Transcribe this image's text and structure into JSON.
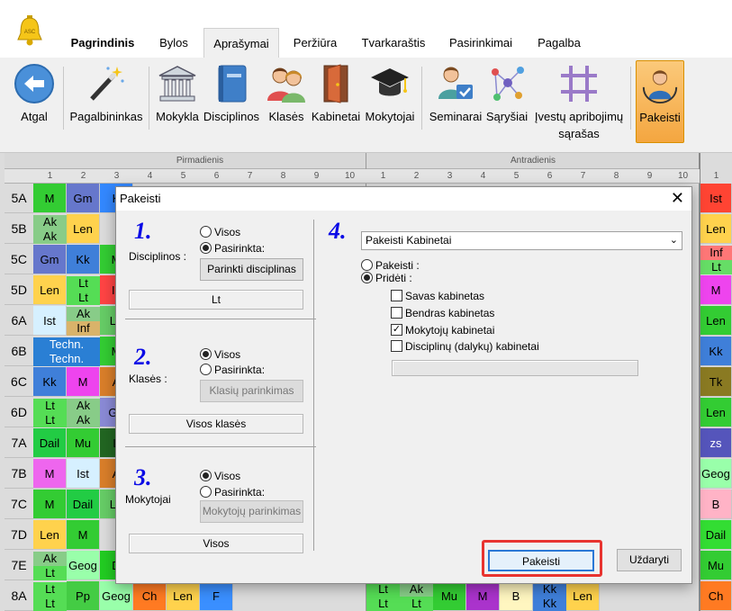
{
  "menu": {
    "tabs": [
      "Pagrindinis",
      "Bylos",
      "Aprašymai",
      "Peržiūra",
      "Tvarkaraštis",
      "Pasirinkimai",
      "Pagalba"
    ]
  },
  "app_logo_text": "ASC",
  "ribbon": {
    "atgal": "Atgal",
    "pagalbininkas": "Pagalbininkas",
    "mokykla": "Mokykla",
    "disciplinos": "Disciplinos",
    "klases": "Klasės",
    "kabinetai": "Kabinetai",
    "mokytojai": "Mokytojai",
    "seminarai": "Seminarai",
    "sarysiai": "Sąryšiai",
    "apribojimai_1": "Įvestų apribojimų",
    "apribojimai_2": "sąrašas",
    "pakeisti": "Pakeisti"
  },
  "grid": {
    "day1": "Pirmadienis",
    "day2": "Antradienis",
    "periods": [
      "1",
      "2",
      "3",
      "4",
      "5",
      "6",
      "7",
      "8",
      "9",
      "10"
    ],
    "right_col_header": "1",
    "rows": [
      "5A",
      "5B",
      "5C",
      "5D",
      "6A",
      "6B",
      "6C",
      "6D",
      "7A",
      "7B",
      "7C",
      "7D",
      "7E",
      "8A"
    ],
    "right_col": [
      "Ist",
      "Len",
      "Inf",
      "Lt",
      "M",
      "Len",
      "Kk",
      "Tk",
      "Len",
      "zs",
      "Geog",
      "B",
      "Dail",
      "Mu",
      "Ch"
    ],
    "cells": {
      "r5A": [
        "M",
        "Gm",
        "K"
      ],
      "r5B": [
        "Ak",
        "Ak",
        "Len"
      ],
      "r5C": [
        "Gm",
        "Kk",
        "M"
      ],
      "r5D": [
        "Len",
        "Lt",
        "Lt",
        "Is"
      ],
      "r6A": [
        "Ist",
        "Ak",
        "Inf",
        "Le"
      ],
      "r6B": [
        "Techn.",
        "Techn.",
        "M"
      ],
      "r6C": [
        "Kk",
        "M",
        "A"
      ],
      "r6D": [
        "Lt",
        "Lt",
        "Ak",
        "Ak",
        "Ge"
      ],
      "r7A": [
        "Dail",
        "Mu",
        "L"
      ],
      "r7B": [
        "M",
        "Ist",
        "A"
      ],
      "r7C": [
        "M",
        "Dail",
        "Le"
      ],
      "r7D": [
        "Len",
        "M"
      ],
      "r7E": [
        "Ak",
        "Lt",
        "Geog",
        "D"
      ],
      "r8A": [
        "Lt",
        "Lt",
        "Pp",
        "Geog",
        "Ch",
        "Len",
        "F",
        "Lt",
        "Lt",
        "Ak",
        "Lt",
        "Mu",
        "M",
        "B",
        "Kk",
        "Kk",
        "Len"
      ]
    }
  },
  "dialog": {
    "title": "Pakeisti",
    "close": "✕",
    "s1_num": "1.",
    "s1_label": "Disciplinos :",
    "s1_opt1": "Visos",
    "s1_opt2": "Pasirinkta:",
    "s1_button": "Parinkti disciplinas",
    "s1_value": "Lt",
    "s2_num": "2.",
    "s2_label": "Klasės :",
    "s2_opt1": "Visos",
    "s2_opt2": "Pasirinkta:",
    "s2_button": "Klasių parinkimas",
    "s2_value": "Visos klasės",
    "s3_num": "3.",
    "s3_label": "Mokytojai",
    "s3_opt1": "Visos",
    "s3_opt2": "Pasirinkta:",
    "s3_button": "Mokytojų parinkimas",
    "s3_value": "Visos",
    "s4_num": "4.",
    "combo_value": "Pakeisti Kabinetai",
    "opt_pakeisti": "Pakeisti :",
    "opt_prideti": "Pridėti :",
    "chk_savas": "Savas kabinetas",
    "chk_bendras": "Bendras kabinetas",
    "chk_mokytoju": "Mokytojų kabinetai",
    "chk_disciplinu": "Disciplinų (dalykų) kabinetai",
    "btn_pakeisti": "Pakeisti",
    "btn_uzdaryti": "Uždaryti"
  },
  "colors": {
    "highlight_red": "#e8332f",
    "selected_ribbon": "#f4a640"
  }
}
